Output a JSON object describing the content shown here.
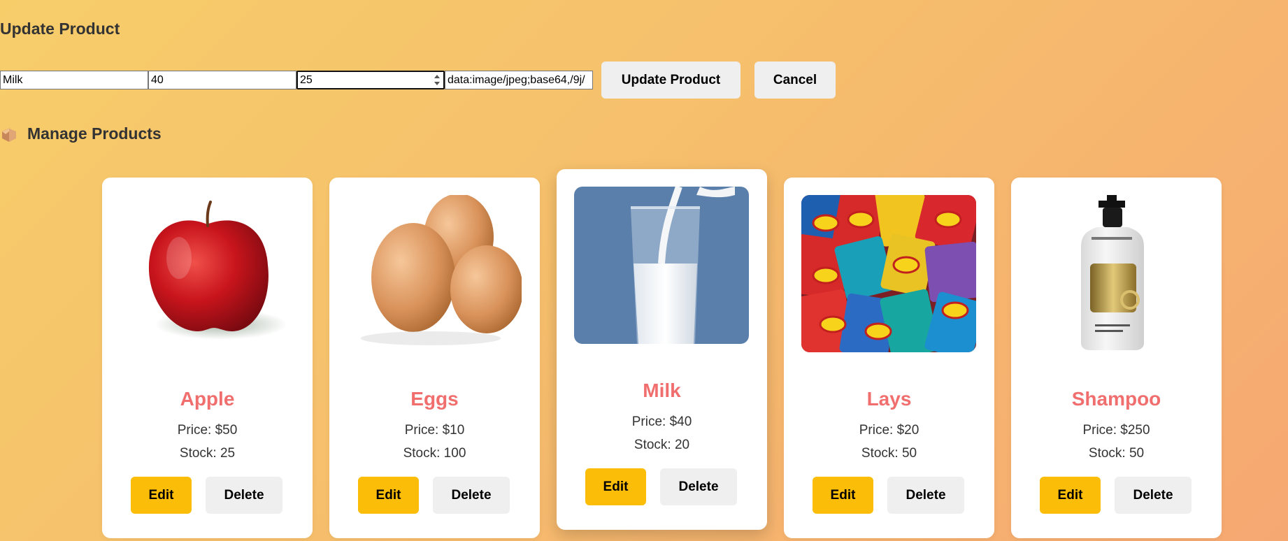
{
  "update_form": {
    "title": "Update Product",
    "name_value": "Milk",
    "price_value": "40",
    "stock_value": "25",
    "image_value": "data:image/jpeg;base64,/9j/",
    "update_label": "Update Product",
    "cancel_label": "Cancel"
  },
  "manage": {
    "title": "Manage Products",
    "icon": "package-icon"
  },
  "products": [
    {
      "name": "Apple",
      "price": "Price: $50",
      "stock": "Stock: 25",
      "image": "apple-image",
      "edit": "Edit",
      "delete": "Delete"
    },
    {
      "name": "Eggs",
      "price": "Price: $10",
      "stock": "Stock: 100",
      "image": "eggs-image",
      "edit": "Edit",
      "delete": "Delete"
    },
    {
      "name": "Milk",
      "price": "Price: $40",
      "stock": "Stock: 20",
      "image": "milk-image",
      "edit": "Edit",
      "delete": "Delete"
    },
    {
      "name": "Lays",
      "price": "Price: $20",
      "stock": "Stock: 50",
      "image": "chips-image",
      "edit": "Edit",
      "delete": "Delete"
    },
    {
      "name": "Shampoo",
      "price": "Price: $250",
      "stock": "Stock: 50",
      "image": "shampoo-image",
      "edit": "Edit",
      "delete": "Delete"
    }
  ],
  "colors": {
    "accent_edit": "#fbbd08",
    "product_name": "#f06e6e",
    "background_start": "#f7cd6a",
    "background_end": "#f6a872"
  }
}
